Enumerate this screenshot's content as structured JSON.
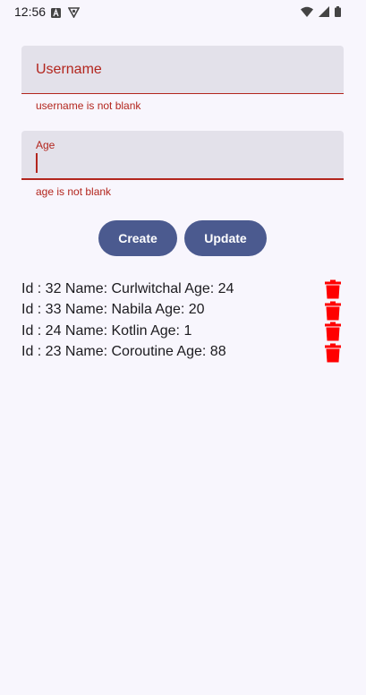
{
  "status_bar": {
    "time": "12:56",
    "icons": [
      "a-badge-icon",
      "shield-icon",
      "wifi-icon",
      "signal-icon",
      "battery-icon"
    ]
  },
  "form": {
    "username": {
      "label": "Username",
      "value": "",
      "error": "username is not blank"
    },
    "age": {
      "label": "Age",
      "value": "",
      "error": "age is not blank"
    },
    "error_color": "#b3261e"
  },
  "buttons": {
    "create": "Create",
    "update": "Update",
    "color": "#4b5a8f"
  },
  "users": [
    {
      "text": "Id : 32 Name: Curlwitchal Age: 24"
    },
    {
      "text": "Id : 33 Name: Nabila Age: 20"
    },
    {
      "text": "Id : 24 Name: Kotlin Age: 1"
    },
    {
      "text": "Id : 23 Name: Coroutine Age: 88"
    }
  ],
  "delete_icon_color": "#ff0000"
}
